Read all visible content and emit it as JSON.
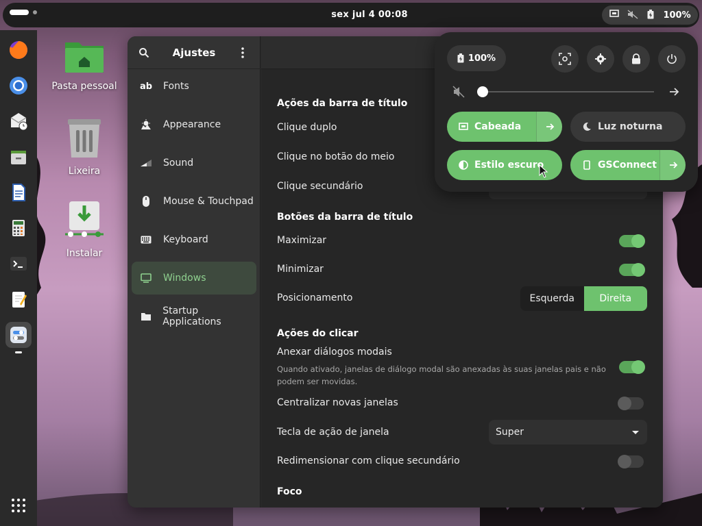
{
  "topbar": {
    "clock": "sex jul 4  00:08",
    "battery": "100%"
  },
  "desktop": {
    "icons": [
      {
        "label": "Pasta pessoal"
      },
      {
        "label": "Lixeira"
      },
      {
        "label": "Instalar"
      }
    ]
  },
  "sidebar": {
    "title": "Ajustes",
    "items": [
      {
        "label": "Fonts",
        "icon": "fonts-icon"
      },
      {
        "label": "Appearance",
        "icon": "appearance-icon"
      },
      {
        "label": "Sound",
        "icon": "sound-icon"
      },
      {
        "label": "Mouse & Touchpad",
        "icon": "mouse-icon"
      },
      {
        "label": "Keyboard",
        "icon": "keyboard-icon"
      },
      {
        "label": "Windows",
        "icon": "monitor-icon",
        "selected": true
      },
      {
        "label": "Startup Applications",
        "icon": "folder-icon"
      }
    ],
    "fonts_glyph": "ab"
  },
  "content": {
    "sections": {
      "titlebar_actions": "Ações da barra de título",
      "titlebar_buttons": "Botões da barra de título",
      "click_actions": "Ações do clicar",
      "focus": "Foco"
    },
    "rows": {
      "double_click": "Clique duplo",
      "middle_click": "Clique no botão do meio",
      "secondary_click": "Clique secundário",
      "maximize": "Maximizar",
      "minimize": "Minimizar",
      "placement": "Posicionamento",
      "attach_modal": "Anexar diálogos modais",
      "attach_modal_desc": "Quando ativado, janelas de diálogo modal são anexadas às suas janelas pais e não podem ser movidas.",
      "center_new": "Centralizar novas janelas",
      "action_key": "Tecla de ação de janela",
      "resize_secondary": "Redimensionar com clique secundário"
    },
    "placement_options": {
      "left": "Esquerda",
      "right": "Direita"
    },
    "action_key_value": "Super"
  },
  "quick_settings": {
    "battery": "100%",
    "tiles": {
      "wired": "Cabeada",
      "night_light": "Luz noturna",
      "dark_style": "Estilo escuro",
      "gsconnect": "GSConnect"
    }
  },
  "colors": {
    "accent": "#6ec26e",
    "panel": "#262626"
  }
}
